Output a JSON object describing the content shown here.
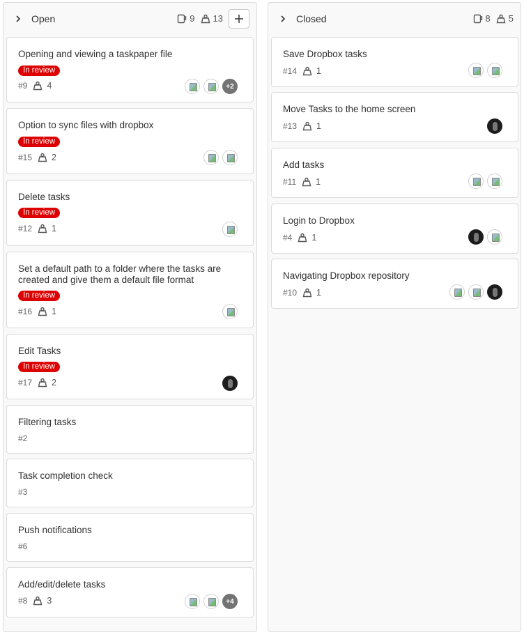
{
  "open": {
    "title": "Open",
    "issue_count": "9",
    "weight_count": "13",
    "add_label": "+",
    "cards": [
      {
        "title": "Opening and viewing a taskpaper file",
        "label": "In review",
        "number": "#9",
        "weight": "4",
        "more": "+2"
      },
      {
        "title": "Option to sync files with dropbox",
        "label": "In review",
        "number": "#15",
        "weight": "2"
      },
      {
        "title": "Delete tasks",
        "label": "In review",
        "number": "#12",
        "weight": "1"
      },
      {
        "title": "Set a default path to a folder where the tasks are created and give them a default file format",
        "label": "In review",
        "number": "#16",
        "weight": "1"
      },
      {
        "title": "Edit Tasks",
        "label": "In review",
        "number": "#17",
        "weight": "2"
      },
      {
        "title": "Filtering tasks",
        "number": "#2"
      },
      {
        "title": "Task completion check",
        "number": "#3"
      },
      {
        "title": "Push notifications",
        "number": "#6"
      },
      {
        "title": "Add/edit/delete tasks",
        "number": "#8",
        "weight": "3",
        "more": "+4"
      }
    ]
  },
  "closed": {
    "title": "Closed",
    "issue_count": "8",
    "weight_count": "5",
    "cards": [
      {
        "title": "Save Dropbox tasks",
        "number": "#14",
        "weight": "1"
      },
      {
        "title": "Move Tasks to the home screen",
        "number": "#13",
        "weight": "1"
      },
      {
        "title": "Add tasks",
        "number": "#11",
        "weight": "1"
      },
      {
        "title": "Login to Dropbox",
        "number": "#4",
        "weight": "1"
      },
      {
        "title": "Navigating Dropbox repository",
        "number": "#10",
        "weight": "1"
      }
    ]
  },
  "colors": {
    "label_red": "#dd0000",
    "column_bg": "#f9f9f9",
    "border": "#dbdbdb"
  },
  "icons": {
    "collapse": "chevron-right-icon",
    "issues": "issues-icon",
    "weight": "weight-icon",
    "add": "plus-icon"
  }
}
